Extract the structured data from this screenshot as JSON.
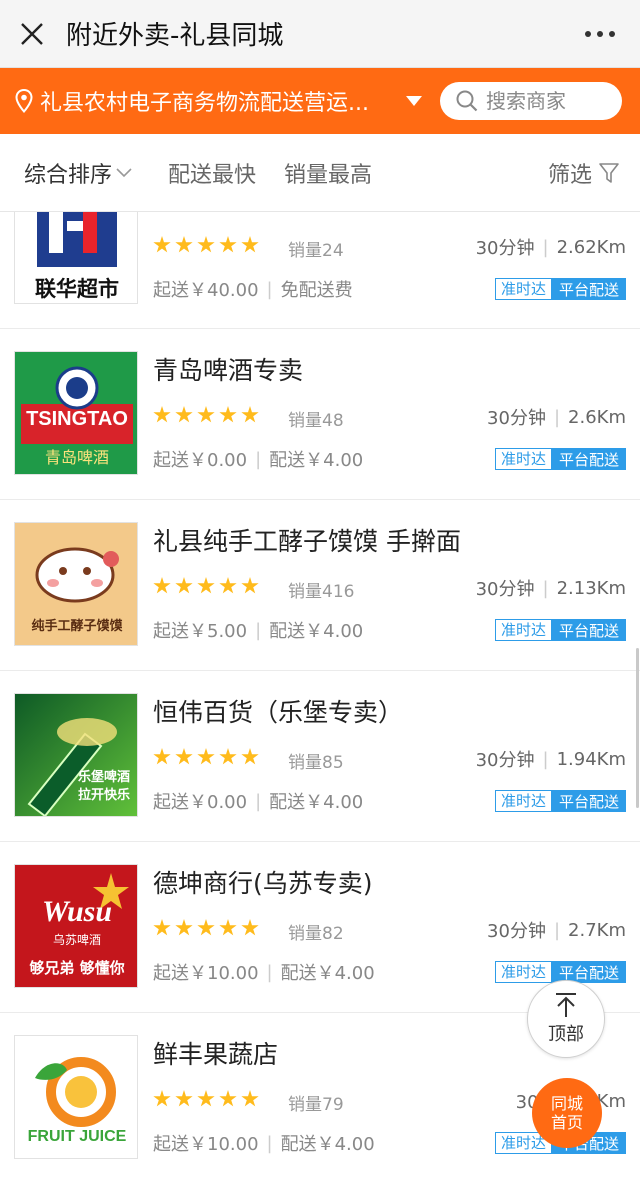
{
  "window": {
    "title": "附近外卖-礼县同城"
  },
  "location": {
    "text": "礼县农村电子商务物流配送营运...",
    "search_placeholder": "搜索商家"
  },
  "sort_options": [
    "综合排序",
    "配送最快",
    "销量最高"
  ],
  "filter_label": "筛选",
  "stores": [
    {
      "name": "联华超市",
      "logo_text": "联华超市",
      "rating": 5,
      "sales": "销量24",
      "time": "30分钟",
      "distance": "2.62Km",
      "min_order": "起送￥40.00",
      "delivery_fee": "免配送费",
      "tag_ontime": "准时达",
      "tag_platform": "平台配送"
    },
    {
      "name": "青岛啤酒专卖",
      "logo_text": "TSINGTAO",
      "logo_subtext": "青岛啤酒",
      "rating": 5,
      "sales": "销量48",
      "time": "30分钟",
      "distance": "2.6Km",
      "min_order": "起送￥0.00",
      "delivery_fee": "配送￥4.00",
      "tag_ontime": "准时达",
      "tag_platform": "平台配送"
    },
    {
      "name": "礼县纯手工酵子馍馍 手擀面",
      "logo_text": "纯手工酵子馍馍",
      "rating": 5,
      "sales": "销量416",
      "time": "30分钟",
      "distance": "2.13Km",
      "min_order": "起送￥5.00",
      "delivery_fee": "配送￥4.00",
      "tag_ontime": "准时达",
      "tag_platform": "平台配送"
    },
    {
      "name": "恒伟百货（乐堡专卖）",
      "logo_text": "乐堡啤酒",
      "logo_subtext": "拉开快乐",
      "rating": 5,
      "sales": "销量85",
      "time": "30分钟",
      "distance": "1.94Km",
      "min_order": "起送￥0.00",
      "delivery_fee": "配送￥4.00",
      "tag_ontime": "准时达",
      "tag_platform": "平台配送"
    },
    {
      "name": "德坤商行(乌苏专卖)",
      "logo_text": "Wusu",
      "logo_subtext": "乌苏啤酒",
      "logo_slogan": "够兄弟 够懂你",
      "rating": 5,
      "sales": "销量82",
      "time": "30分钟",
      "distance": "2.7Km",
      "min_order": "起送￥10.00",
      "delivery_fee": "配送￥4.00",
      "tag_ontime": "准时达",
      "tag_platform": "平台配送"
    },
    {
      "name": "鲜丰果蔬店",
      "logo_text": "FRUIT JUICE",
      "rating": 5,
      "sales": "销量79",
      "time": "30分钟",
      "distance": "Km",
      "min_order": "起送￥10.00",
      "delivery_fee": "配送￥4.00",
      "tag_ontime": "准时达",
      "tag_platform": "平台配送"
    }
  ],
  "float_buttons": {
    "top": "顶部",
    "home_line1": "同城",
    "home_line2": "首页"
  },
  "colors": {
    "accent": "#ff6a13",
    "star": "#ffbb1c",
    "tag_blue": "#2d9ce8"
  }
}
